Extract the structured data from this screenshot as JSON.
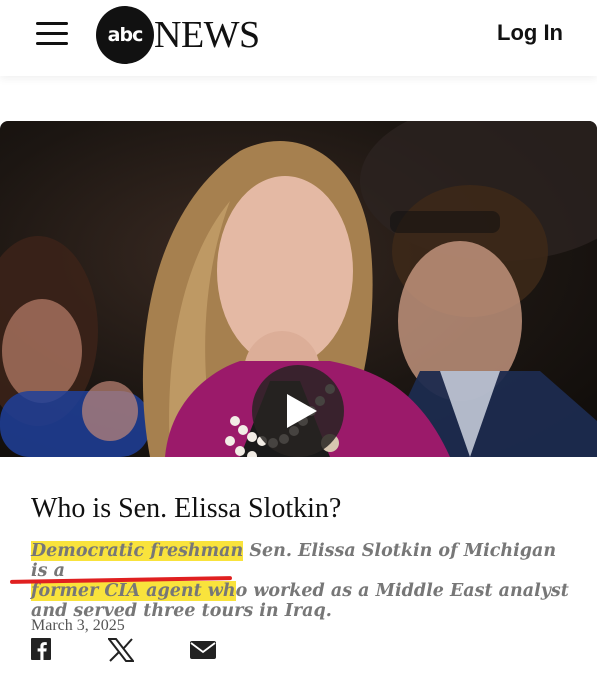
{
  "header": {
    "logo_mark": "abc",
    "logo_text": "NEWS",
    "login_label": "Log In"
  },
  "video": {
    "play_icon": "play-icon"
  },
  "article": {
    "headline": "Who is Sen. Elissa Slotkin?",
    "summary_hl_1": "Democratic freshman",
    "summary_rest_1": " Sen. Elissa Slotkin of Michigan is a",
    "summary_hl_2": "former CIA agent wh",
    "summary_rest_2": "o worked as a Middle East analyst",
    "summary_line_3": "and served three tours in Iraq.",
    "date": "March 3, 2025"
  },
  "share": [
    "facebook-icon",
    "x-icon",
    "email-icon"
  ],
  "colors": {
    "highlight": "#f9e33c",
    "underline": "#e02020",
    "accent_jacket": "#9b1a6a"
  }
}
